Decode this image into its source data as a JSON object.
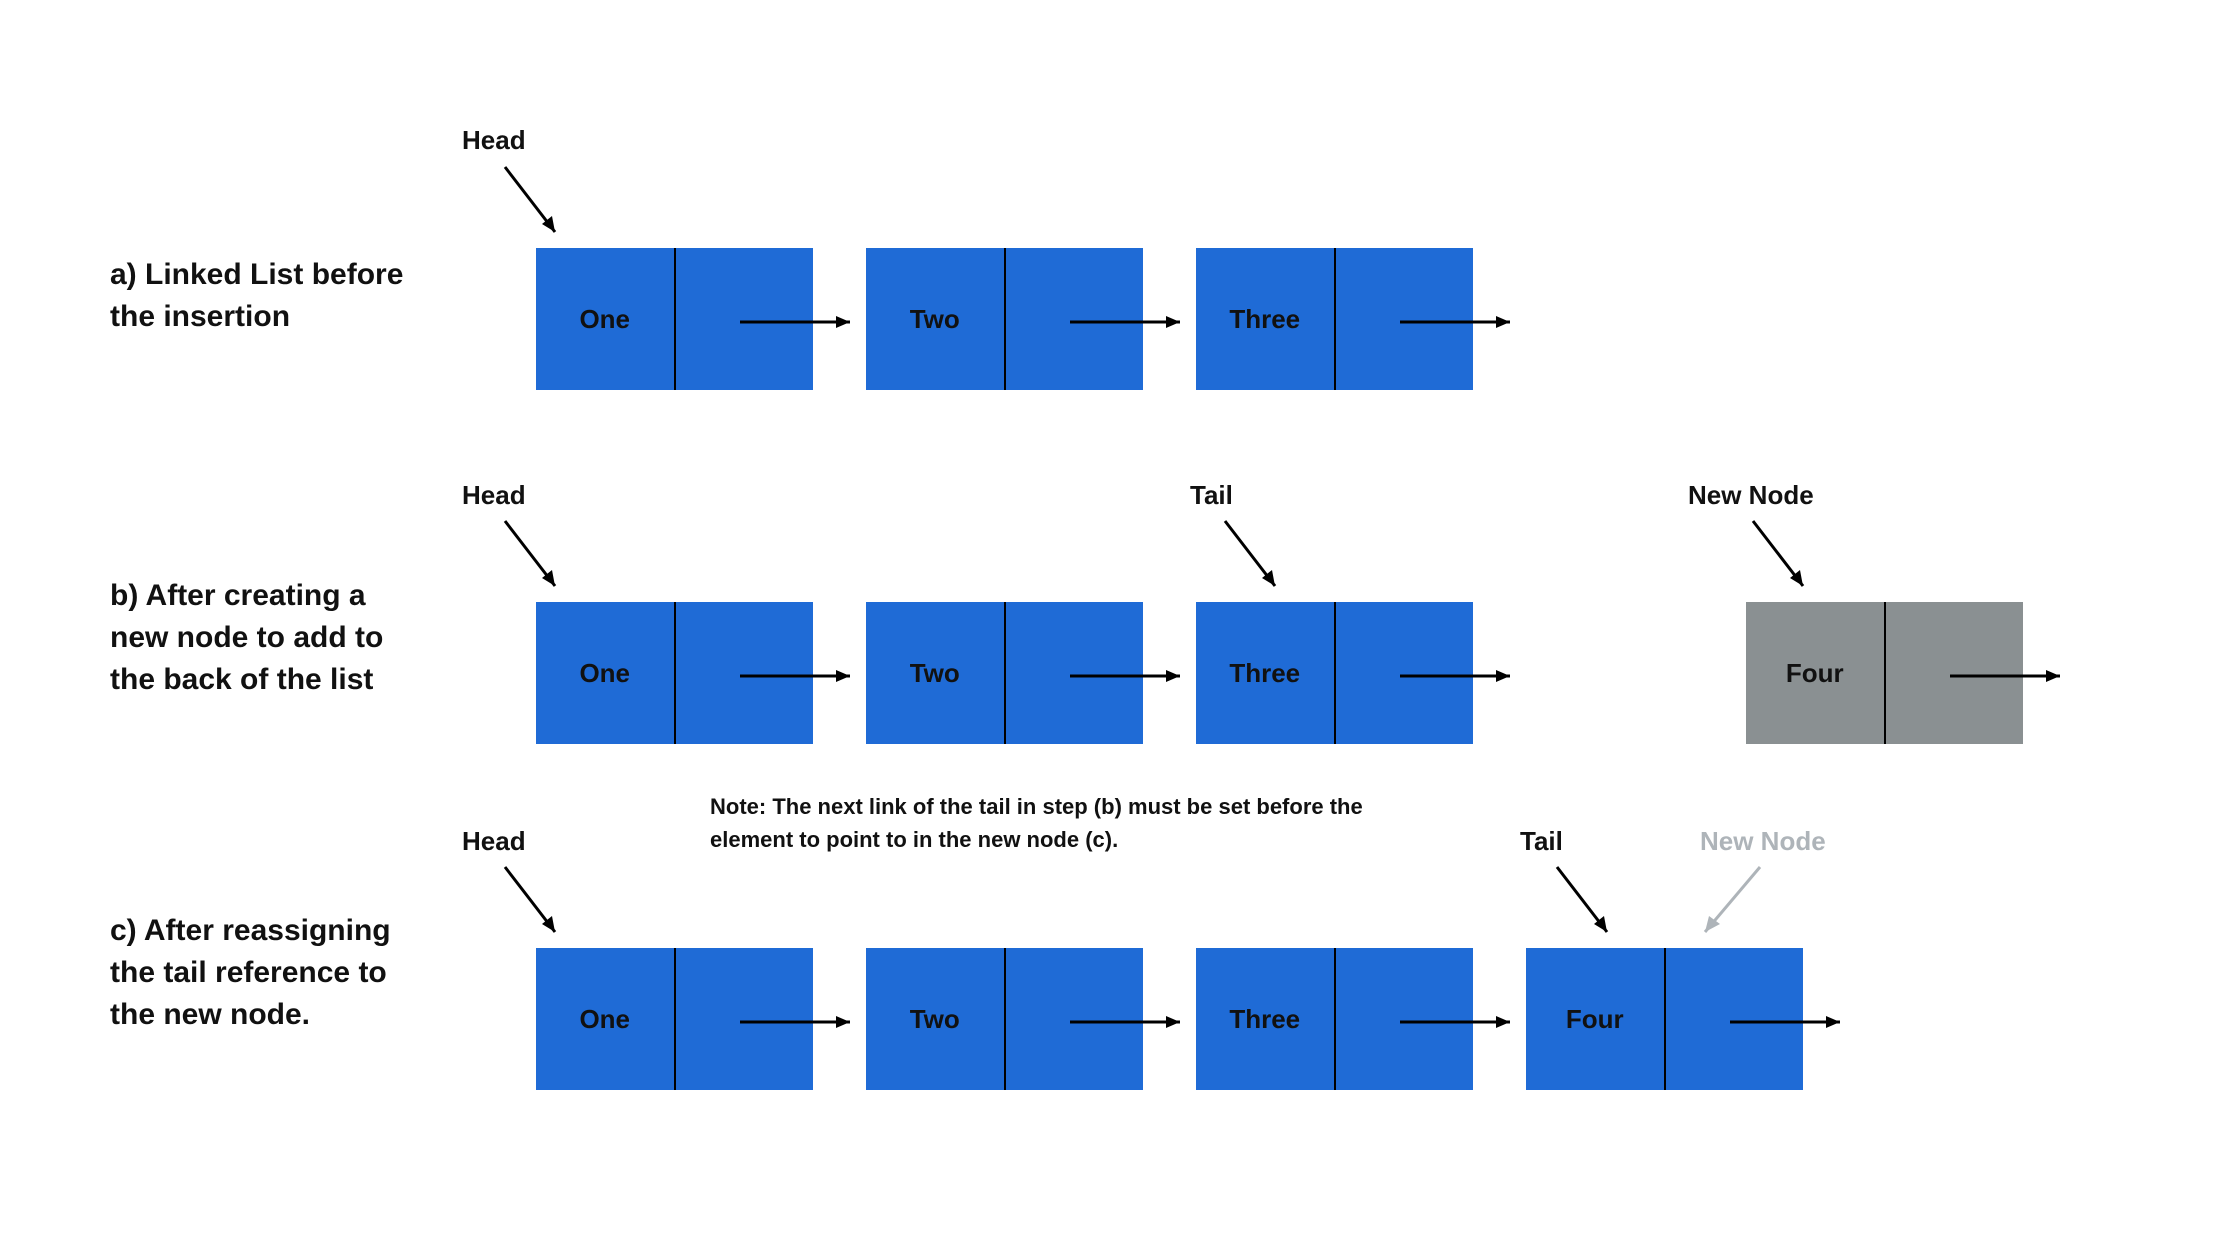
{
  "rows": {
    "a": {
      "desc": "a) Linked List before the insertion",
      "head_label": "Head",
      "nodes": [
        "One",
        "Two",
        "Three"
      ]
    },
    "b": {
      "desc": "b) After creating a new node to add to the back of the list",
      "head_label": "Head",
      "tail_label": "Tail",
      "newnode_label": "New Node",
      "nodes": [
        "One",
        "Two",
        "Three"
      ],
      "new_node": "Four"
    },
    "c": {
      "desc": "c) After reassigning the tail reference to the new node.",
      "head_label": "Head",
      "tail_label": "Tail",
      "newnode_label": "New Node",
      "note": "Note: The next link of the tail in step (b) must be set before the element to point to in the new node (c).",
      "nodes": [
        "One",
        "Two",
        "Three",
        "Four"
      ]
    }
  }
}
